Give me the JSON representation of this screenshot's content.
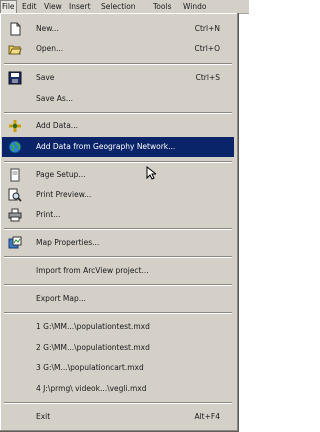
{
  "menubar": {
    "file": "File",
    "edit": "Edit",
    "view": "View",
    "insert": "Insert",
    "selection": "Selection",
    "tools": "Tools",
    "window": "Windo"
  },
  "file_menu": {
    "new": {
      "label": "New...",
      "shortcut": "Ctrl+N",
      "icon": "new-document-icon"
    },
    "open": {
      "label": "Open...",
      "shortcut": "Ctrl+O",
      "icon": "open-folder-icon"
    },
    "save": {
      "label": "Save",
      "shortcut": "Ctrl+S",
      "icon": "save-disk-icon"
    },
    "save_as": {
      "label": "Save As..."
    },
    "add_data": {
      "label": "Add Data...",
      "icon": "add-data-icon"
    },
    "add_data_geography": {
      "label": "Add Data from Geography Network...",
      "icon": "globe-icon"
    },
    "page_setup": {
      "label": "Page Setup...",
      "icon": "page-setup-icon"
    },
    "print_preview": {
      "label": "Print Preview...",
      "icon": "print-preview-icon"
    },
    "print": {
      "label": "Print...",
      "icon": "printer-icon"
    },
    "map_properties": {
      "label": "Map Properties...",
      "icon": "map-properties-icon"
    },
    "import_arcview": {
      "label": "Import from ArcView project..."
    },
    "export_map": {
      "label": "Export Map..."
    },
    "recent_1": {
      "label": "1 G:\\MM...\\populationtest.mxd"
    },
    "recent_2": {
      "label": "2 G:\\MM...\\populationtest.mxd"
    },
    "recent_3": {
      "label": "3 G:\\M...\\populationcart.mxd"
    },
    "recent_4": {
      "label": "4 J:\\prmg\\ videok...\\vegli.mxd"
    },
    "exit": {
      "label": "Exit",
      "shortcut": "Alt+F4"
    }
  },
  "colors": {
    "menu_bg": "#d4d0c8",
    "highlight_bg": "#0a246a",
    "highlight_text": "#ffffff"
  }
}
